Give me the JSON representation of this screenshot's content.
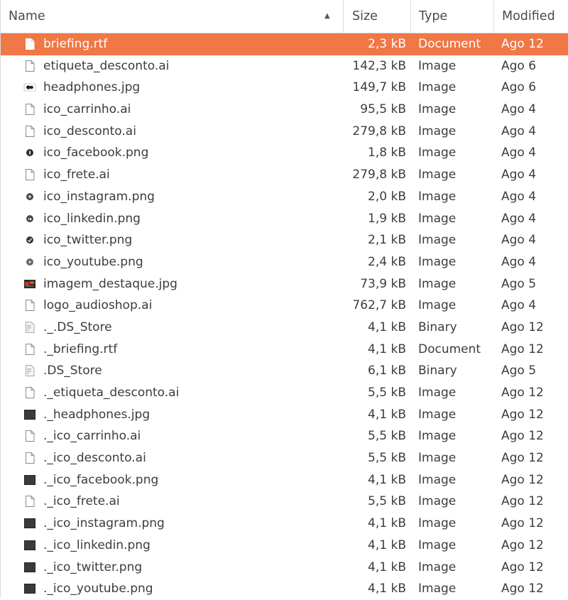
{
  "columns": {
    "name": "Name",
    "size": "Size",
    "type": "Type",
    "modified": "Modified",
    "sort_indicator": "▲"
  },
  "files": [
    {
      "name": "briefing.rtf",
      "size": "2,3 kB",
      "type": "Document",
      "modified": "Ago 12",
      "icon": "document-icon",
      "selected": true
    },
    {
      "name": "etiqueta_desconto.ai",
      "size": "142,3 kB",
      "type": "Image",
      "modified": "Ago 6",
      "icon": "document-icon"
    },
    {
      "name": "headphones.jpg",
      "size": "149,7 kB",
      "type": "Image",
      "modified": "Ago 6",
      "icon": "headphones-thumbnail-icon"
    },
    {
      "name": "ico_carrinho.ai",
      "size": "95,5 kB",
      "type": "Image",
      "modified": "Ago 4",
      "icon": "document-icon"
    },
    {
      "name": "ico_desconto.ai",
      "size": "279,8 kB",
      "type": "Image",
      "modified": "Ago 4",
      "icon": "document-icon"
    },
    {
      "name": "ico_facebook.png",
      "size": "1,8 kB",
      "type": "Image",
      "modified": "Ago 4",
      "icon": "facebook-thumbnail-icon"
    },
    {
      "name": "ico_frete.ai",
      "size": "279,8 kB",
      "type": "Image",
      "modified": "Ago 4",
      "icon": "document-icon"
    },
    {
      "name": "ico_instagram.png",
      "size": "2,0 kB",
      "type": "Image",
      "modified": "Ago 4",
      "icon": "instagram-thumbnail-icon"
    },
    {
      "name": "ico_linkedin.png",
      "size": "1,9 kB",
      "type": "Image",
      "modified": "Ago 4",
      "icon": "linkedin-thumbnail-icon"
    },
    {
      "name": "ico_twitter.png",
      "size": "2,1 kB",
      "type": "Image",
      "modified": "Ago 4",
      "icon": "twitter-thumbnail-icon"
    },
    {
      "name": "ico_youtube.png",
      "size": "2,4 kB",
      "type": "Image",
      "modified": "Ago 4",
      "icon": "youtube-thumbnail-icon"
    },
    {
      "name": "imagem_destaque.jpg",
      "size": "73,9 kB",
      "type": "Image",
      "modified": "Ago 5",
      "icon": "photo-thumbnail-icon"
    },
    {
      "name": "logo_audioshop.ai",
      "size": "762,7 kB",
      "type": "Image",
      "modified": "Ago 4",
      "icon": "document-icon"
    },
    {
      "name": "._.DS_Store",
      "size": "4,1 kB",
      "type": "Binary",
      "modified": "Ago 12",
      "icon": "binary-file-icon"
    },
    {
      "name": "._briefing.rtf",
      "size": "4,1 kB",
      "type": "Document",
      "modified": "Ago 12",
      "icon": "document-icon"
    },
    {
      "name": ".DS_Store",
      "size": "6,1 kB",
      "type": "Binary",
      "modified": "Ago 5",
      "icon": "binary-file-icon"
    },
    {
      "name": "._etiqueta_desconto.ai",
      "size": "5,5 kB",
      "type": "Image",
      "modified": "Ago 12",
      "icon": "document-icon"
    },
    {
      "name": "._headphones.jpg",
      "size": "4,1 kB",
      "type": "Image",
      "modified": "Ago 12",
      "icon": "dark-image-icon"
    },
    {
      "name": "._ico_carrinho.ai",
      "size": "5,5 kB",
      "type": "Image",
      "modified": "Ago 12",
      "icon": "document-icon"
    },
    {
      "name": "._ico_desconto.ai",
      "size": "5,5 kB",
      "type": "Image",
      "modified": "Ago 12",
      "icon": "document-icon"
    },
    {
      "name": "._ico_facebook.png",
      "size": "4,1 kB",
      "type": "Image",
      "modified": "Ago 12",
      "icon": "dark-image-icon"
    },
    {
      "name": "._ico_frete.ai",
      "size": "5,5 kB",
      "type": "Image",
      "modified": "Ago 12",
      "icon": "document-icon"
    },
    {
      "name": "._ico_instagram.png",
      "size": "4,1 kB",
      "type": "Image",
      "modified": "Ago 12",
      "icon": "dark-image-icon"
    },
    {
      "name": "._ico_linkedin.png",
      "size": "4,1 kB",
      "type": "Image",
      "modified": "Ago 12",
      "icon": "dark-image-icon"
    },
    {
      "name": "._ico_twitter.png",
      "size": "4,1 kB",
      "type": "Image",
      "modified": "Ago 12",
      "icon": "dark-image-icon"
    },
    {
      "name": "._ico_youtube.png",
      "size": "4,1 kB",
      "type": "Image",
      "modified": "Ago 12",
      "icon": "dark-image-icon"
    }
  ],
  "colors": {
    "selection": "#f07746",
    "text": "#3c3c3c"
  }
}
